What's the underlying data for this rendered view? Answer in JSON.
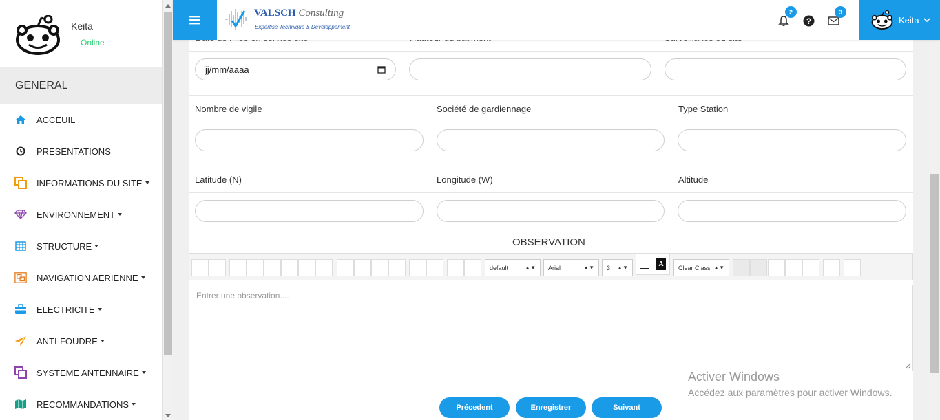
{
  "user": {
    "name": "Keita",
    "status": "Online"
  },
  "sidebar": {
    "section_title": "GENERAL",
    "items": [
      {
        "label": "ACCEUIL",
        "icon": "home-icon",
        "color": "#1a9be7",
        "dropdown": false
      },
      {
        "label": "PRESENTATIONS",
        "icon": "clock-icon",
        "color": "#222222",
        "dropdown": false
      },
      {
        "label": "INFORMATIONS DU SITE",
        "icon": "copy-icon",
        "color": "#f39c12",
        "dropdown": true
      },
      {
        "label": "ENVIRONNEMENT",
        "icon": "diamond-icon",
        "color": "#8e44ad",
        "dropdown": true
      },
      {
        "label": "STRUCTURE",
        "icon": "table-icon",
        "color": "#1a9be7",
        "dropdown": true
      },
      {
        "label": "NAVIGATION AERIENNE",
        "icon": "object-group-icon",
        "color": "#e67e22",
        "dropdown": true
      },
      {
        "label": "ELECTRICITE",
        "icon": "briefcase-icon",
        "color": "#1a9be7",
        "dropdown": true
      },
      {
        "label": "ANTI-FOUDRE",
        "icon": "paper-plane-icon",
        "color": "#f39c12",
        "dropdown": true
      },
      {
        "label": "SYSTEME ANTENNAIRE",
        "icon": "clone-icon",
        "color": "#8e44ad",
        "dropdown": true
      },
      {
        "label": "RECOMMANDATIONS",
        "icon": "map-icon",
        "color": "#16a085",
        "dropdown": true
      }
    ]
  },
  "header": {
    "logo_name": "VALSCH",
    "logo_consulting": "Consulting",
    "logo_tagline": "Expertise Technique & Développement",
    "notifications_count": "2",
    "messages_count": "3",
    "user_label": "Keita"
  },
  "form": {
    "cut_labels": [
      "Date de mise en service site",
      "Hauteur du bâtiment",
      "Surveillance du site"
    ],
    "date_placeholder": "jj/mm/aaaa",
    "row2_labels": [
      "Nombre de vigile",
      "Société de gardiennage",
      "Type Station"
    ],
    "row3_labels": [
      "Latitude (N)",
      "Longitude (W)",
      "Altitude"
    ],
    "observation_title": "OBSERVATION",
    "editor_placeholder": "Entrer une observation....",
    "toolbar": {
      "style": "default",
      "font": "Arial",
      "size": "3",
      "clear_class": "Clear Class"
    },
    "buttons": {
      "previous": "Précedent",
      "save": "Enregistrer",
      "next": "Suivant"
    }
  },
  "watermark": {
    "line1": "Activer Windows",
    "line2": "Accédez aux paramètres pour activer Windows."
  },
  "colors": {
    "accent": "#1a9be7",
    "online": "#2ecc71"
  }
}
